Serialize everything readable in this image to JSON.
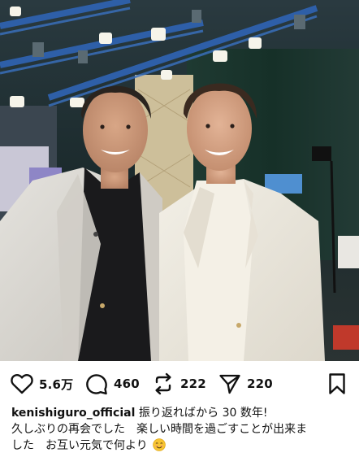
{
  "post": {
    "likes": "5.6万",
    "comments": "460",
    "reposts": "222",
    "shares": "220",
    "username": "kenishiguro_official",
    "caption_line1": "振り返ればから 30 数年!",
    "caption_line2": "久しぶりの再会でした　楽しい時間を過ごすことが出来ま",
    "caption_line3": "した　お互い元気で何より",
    "caption_emoji": "smiling-face-emoji"
  },
  "icons": {
    "like": "heart-icon",
    "comment": "comment-bubble-icon",
    "repost": "repost-arrows-icon",
    "share": "send-paper-plane-icon",
    "save": "bookmark-icon"
  },
  "colors": {
    "text": "#111111",
    "studio_dark": "#1d2a30",
    "rig_blue": "#2e5fa8",
    "jacket": "#d9d6cf"
  }
}
